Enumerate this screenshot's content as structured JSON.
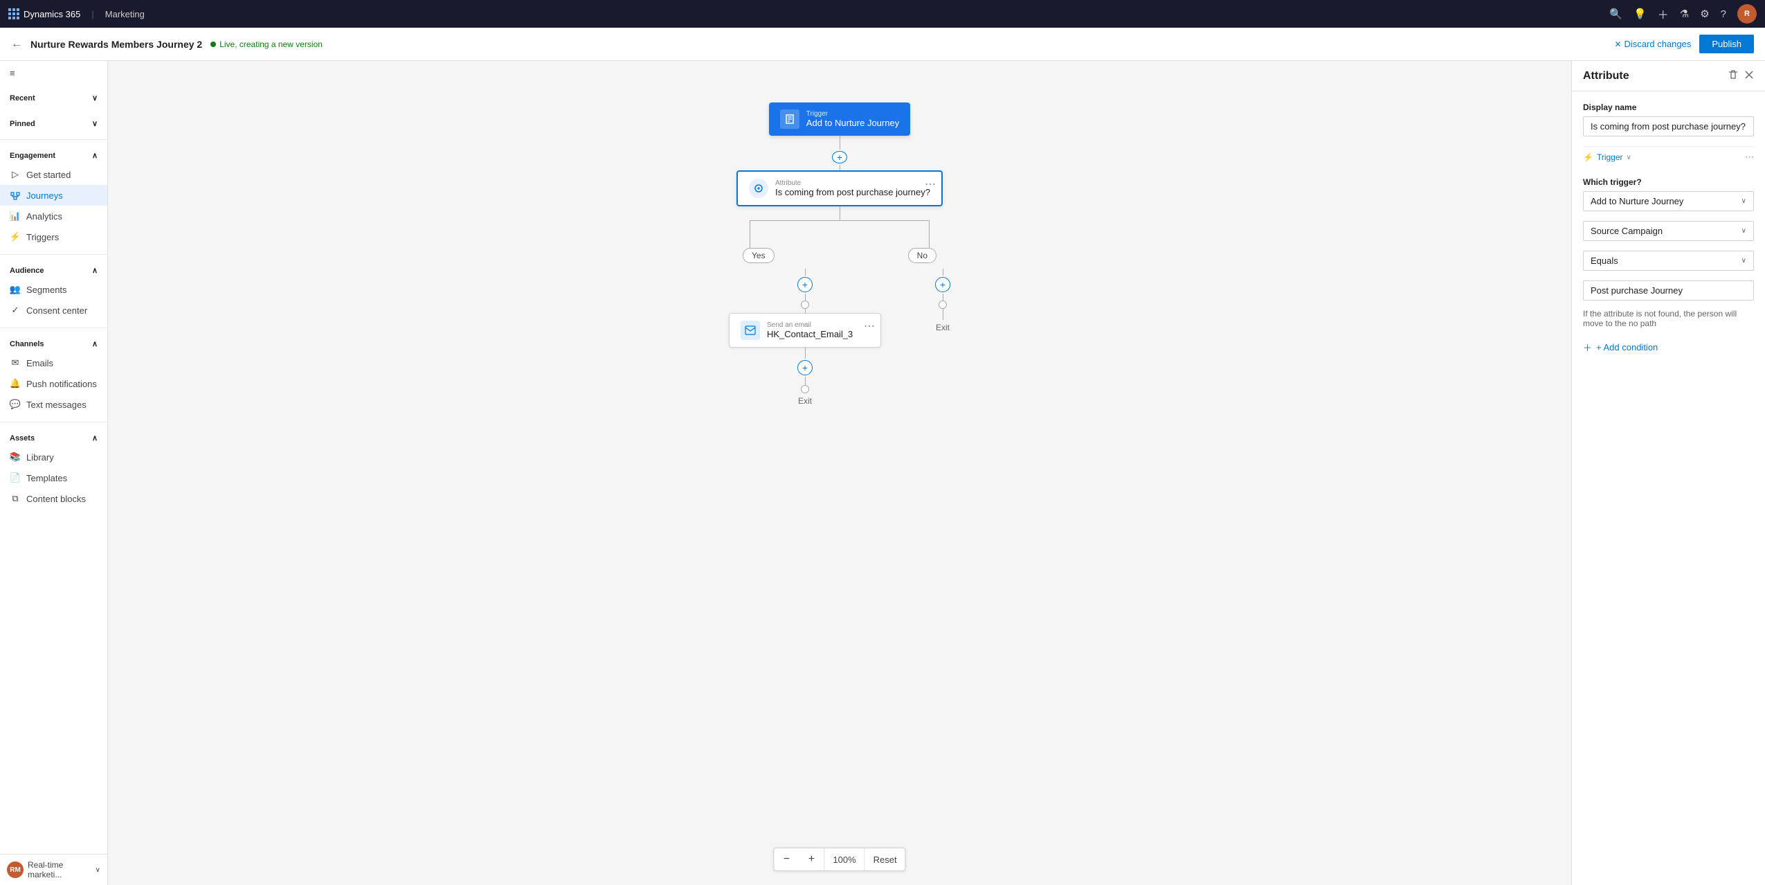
{
  "topbar": {
    "app_name": "Dynamics 365",
    "module": "Marketing"
  },
  "subheader": {
    "journey_title": "Nurture Rewards Members Journey 2",
    "status": "Live, creating a new version",
    "discard_label": "Discard changes",
    "publish_label": "Publish",
    "back_icon": "←"
  },
  "sidebar": {
    "hamburger_icon": "≡",
    "sections": [
      {
        "label": "Recent",
        "collapsible": true
      },
      {
        "label": "Pinned",
        "collapsible": true
      }
    ],
    "groups": [
      {
        "label": "Engagement",
        "items": [
          {
            "label": "Get started",
            "icon": "▷"
          },
          {
            "label": "Journeys",
            "icon": "🔀",
            "active": true
          },
          {
            "label": "Analytics",
            "icon": "📊"
          },
          {
            "label": "Triggers",
            "icon": "⚡"
          }
        ]
      },
      {
        "label": "Audience",
        "items": [
          {
            "label": "Segments",
            "icon": "👥"
          },
          {
            "label": "Consent center",
            "icon": "✓"
          }
        ]
      },
      {
        "label": "Channels",
        "items": [
          {
            "label": "Emails",
            "icon": "✉"
          },
          {
            "label": "Push notifications",
            "icon": "🔔"
          },
          {
            "label": "Text messages",
            "icon": "💬"
          }
        ]
      },
      {
        "label": "Assets",
        "items": [
          {
            "label": "Library",
            "icon": "📚"
          },
          {
            "label": "Templates",
            "icon": "📄"
          },
          {
            "label": "Content blocks",
            "icon": "⧉"
          }
        ]
      }
    ],
    "footer": {
      "label": "Real-time marketi...",
      "avatar_text": "RM"
    }
  },
  "canvas": {
    "nodes": {
      "trigger": {
        "label": "Trigger",
        "name": "Add to Nurture Journey"
      },
      "attribute": {
        "label": "Attribute",
        "name": "Is coming from post purchase journey?"
      },
      "yes_branch": {
        "label": "Yes"
      },
      "no_branch": {
        "label": "No"
      },
      "email": {
        "label": "Send an email",
        "name": "HK_Contact_Email_3"
      },
      "exit_yes": "Exit",
      "exit_no": "Exit"
    },
    "zoom": {
      "value": "100%",
      "reset_label": "Reset"
    }
  },
  "right_panel": {
    "title": "Attribute",
    "display_name_label": "Display name",
    "display_name_value": "Is coming from post purchase journey?",
    "trigger_label": "Trigger",
    "trigger_chevron": "∨",
    "which_trigger_label": "Which trigger?",
    "trigger_value": "Add to Nurture Journey",
    "source_campaign_value": "Source Campaign",
    "equals_value": "Equals",
    "post_purchase_value": "Post purchase Journey",
    "hint_text": "If the attribute is not found, the person will move to the no path",
    "add_condition_label": "+ Add condition",
    "more_icon": "⋯"
  }
}
